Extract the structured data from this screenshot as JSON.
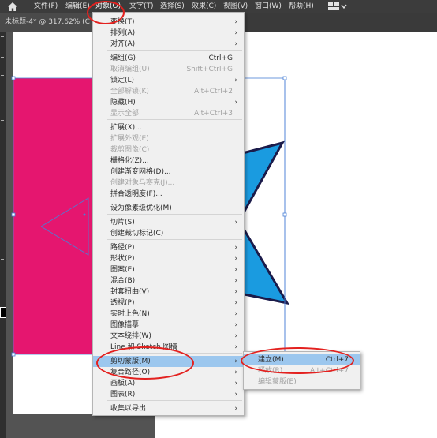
{
  "menubar": {
    "items": [
      "文件(F)",
      "编辑(E)",
      "对象(O)",
      "文字(T)",
      "选择(S)",
      "效果(C)",
      "视图(V)",
      "窗口(W)",
      "帮助(H)"
    ]
  },
  "document_tab": {
    "title": "未标题-4* @ 317.62% (C"
  },
  "object_menu": {
    "items": [
      {
        "label": "变换(T)",
        "shortcut": "",
        "submenu": true,
        "disabled": false
      },
      {
        "label": "排列(A)",
        "shortcut": "",
        "submenu": true,
        "disabled": false
      },
      {
        "label": "对齐(A)",
        "shortcut": "",
        "submenu": true,
        "disabled": false
      },
      {
        "label": "编组(G)",
        "shortcut": "Ctrl+G",
        "submenu": false,
        "disabled": false
      },
      {
        "label": "取消编组(U)",
        "shortcut": "Shift+Ctrl+G",
        "submenu": false,
        "disabled": true
      },
      {
        "label": "锁定(L)",
        "shortcut": "",
        "submenu": true,
        "disabled": false
      },
      {
        "label": "全部解锁(K)",
        "shortcut": "Alt+Ctrl+2",
        "submenu": false,
        "disabled": true
      },
      {
        "label": "隐藏(H)",
        "shortcut": "",
        "submenu": true,
        "disabled": false
      },
      {
        "label": "显示全部",
        "shortcut": "Alt+Ctrl+3",
        "submenu": false,
        "disabled": true
      },
      {
        "label": "扩展(X)...",
        "shortcut": "",
        "submenu": false,
        "disabled": false
      },
      {
        "label": "扩展外观(E)",
        "shortcut": "",
        "submenu": false,
        "disabled": true
      },
      {
        "label": "裁剪图像(C)",
        "shortcut": "",
        "submenu": false,
        "disabled": true
      },
      {
        "label": "栅格化(Z)...",
        "shortcut": "",
        "submenu": false,
        "disabled": false
      },
      {
        "label": "创建渐变网格(D)...",
        "shortcut": "",
        "submenu": false,
        "disabled": false
      },
      {
        "label": "创建对象马赛克(J)...",
        "shortcut": "",
        "submenu": false,
        "disabled": true
      },
      {
        "label": "拼合透明度(F)...",
        "shortcut": "",
        "submenu": false,
        "disabled": false
      },
      {
        "label": "设为像素级优化(M)",
        "shortcut": "",
        "submenu": false,
        "disabled": false
      },
      {
        "label": "切片(S)",
        "shortcut": "",
        "submenu": true,
        "disabled": false
      },
      {
        "label": "创建裁切标记(C)",
        "shortcut": "",
        "submenu": false,
        "disabled": false
      },
      {
        "label": "路径(P)",
        "shortcut": "",
        "submenu": true,
        "disabled": false
      },
      {
        "label": "形状(P)",
        "shortcut": "",
        "submenu": true,
        "disabled": false
      },
      {
        "label": "图案(E)",
        "shortcut": "",
        "submenu": true,
        "disabled": false
      },
      {
        "label": "混合(B)",
        "shortcut": "",
        "submenu": true,
        "disabled": false
      },
      {
        "label": "封套扭曲(V)",
        "shortcut": "",
        "submenu": true,
        "disabled": false
      },
      {
        "label": "透视(P)",
        "shortcut": "",
        "submenu": true,
        "disabled": false
      },
      {
        "label": "实时上色(N)",
        "shortcut": "",
        "submenu": true,
        "disabled": false
      },
      {
        "label": "图像描摹",
        "shortcut": "",
        "submenu": true,
        "disabled": false
      },
      {
        "label": "文本绕排(W)",
        "shortcut": "",
        "submenu": true,
        "disabled": false
      },
      {
        "label": "Line 和 Sketch 图稿",
        "shortcut": "",
        "submenu": true,
        "disabled": false
      },
      {
        "label": "剪切蒙版(M)",
        "shortcut": "",
        "submenu": true,
        "disabled": false,
        "highlighted": true
      },
      {
        "label": "复合路径(O)",
        "shortcut": "",
        "submenu": true,
        "disabled": false
      },
      {
        "label": "画板(A)",
        "shortcut": "",
        "submenu": true,
        "disabled": false
      },
      {
        "label": "图表(R)",
        "shortcut": "",
        "submenu": true,
        "disabled": false
      },
      {
        "label": "收集以导出",
        "shortcut": "",
        "submenu": true,
        "disabled": false
      }
    ]
  },
  "clipping_mask_submenu": {
    "items": [
      {
        "label": "建立(M)",
        "shortcut": "Ctrl+7",
        "disabled": false,
        "highlighted": true
      },
      {
        "label": "释放(R)",
        "shortcut": "Alt+Ctrl+7",
        "disabled": true
      },
      {
        "label": "编辑蒙版(E)",
        "shortcut": "",
        "disabled": true
      }
    ]
  },
  "colors": {
    "pink_fill": "#e5166f",
    "blue_fill": "#1a9be0",
    "annotation_red": "#e3211f",
    "menu_highlight": "#9cc7ee"
  },
  "icons": [
    "home-icon",
    "workspace-switcher-icon",
    "chevron-down-icon",
    "submenu-arrow-icon"
  ]
}
